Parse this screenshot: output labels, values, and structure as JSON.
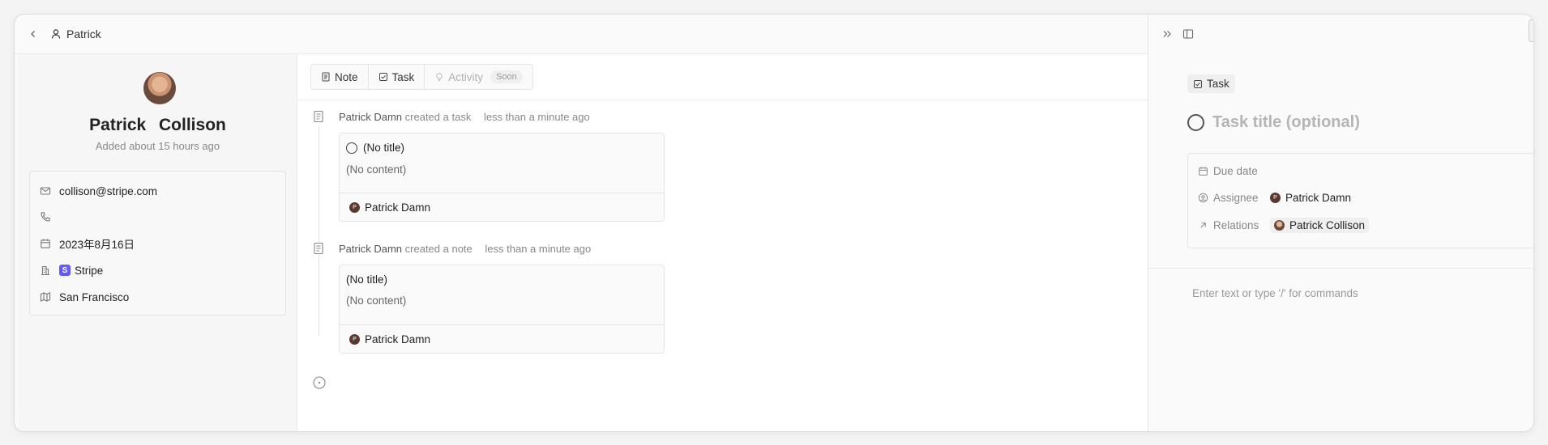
{
  "topbar": {
    "crumb_label": "Patrick"
  },
  "profile": {
    "name": "Patrick Collison",
    "added": "Added about 15 hours ago",
    "fields": {
      "email": "collison@stripe.com",
      "phone": "",
      "date": "2023年8月16日",
      "company": "Stripe",
      "company_logo": "S",
      "city": "San Francisco"
    }
  },
  "tabs": {
    "note": "Note",
    "task": "Task",
    "activity": "Activity",
    "soon": "Soon"
  },
  "timeline": [
    {
      "actor": "Patrick Damn",
      "action": "created a task",
      "when": "less than a minute ago",
      "title": "(No title)",
      "content": "(No content)",
      "footer_user": "Patrick Damn",
      "footer_initial": "P"
    },
    {
      "actor": "Patrick Damn",
      "action": "created a note",
      "when": "less than a minute ago",
      "title": "(No title)",
      "content": "(No content)",
      "footer_user": "Patrick Damn",
      "footer_initial": "P"
    }
  ],
  "right_panel": {
    "chip_label": "Task",
    "title_placeholder": "Task title (optional)",
    "props": {
      "due_label": "Due date",
      "assignee_label": "Assignee",
      "assignee_value": "Patrick Damn",
      "assignee_initial": "P",
      "relations_label": "Relations",
      "relations_value": "Patrick Collison"
    },
    "editor_placeholder": "Enter text or type '/' for commands"
  }
}
